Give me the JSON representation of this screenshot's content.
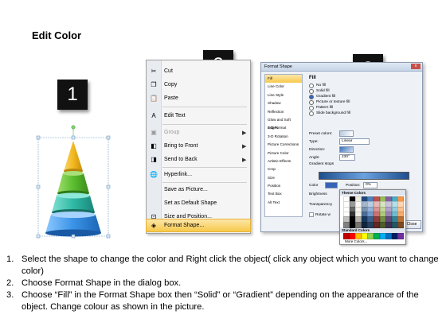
{
  "title": "Edit Color",
  "badges": [
    "1",
    "2",
    "3"
  ],
  "context_menu": {
    "items": [
      {
        "label": "Cut",
        "icon": "scissors-icon",
        "glyph": "✂",
        "disabled": false,
        "submenu": false
      },
      {
        "label": "Copy",
        "icon": "copy-icon",
        "glyph": "❐",
        "disabled": false,
        "submenu": false
      },
      {
        "label": "Paste",
        "icon": "paste-icon",
        "glyph": "📋",
        "disabled": false,
        "submenu": false
      },
      {
        "label": "Edit Text",
        "icon": "edit-text-icon",
        "glyph": "A",
        "disabled": false,
        "submenu": false
      },
      {
        "label": "Group",
        "icon": "group-icon",
        "glyph": "▣",
        "disabled": true,
        "submenu": true
      },
      {
        "label": "Bring to Front",
        "icon": "bring-front-icon",
        "glyph": "◧",
        "disabled": false,
        "submenu": true
      },
      {
        "label": "Send to Back",
        "icon": "send-back-icon",
        "glyph": "◨",
        "disabled": false,
        "submenu": true
      },
      {
        "label": "Hyperlink...",
        "icon": "hyperlink-icon",
        "glyph": "🌐",
        "disabled": false,
        "submenu": false
      },
      {
        "label": "Save as Picture...",
        "icon": "",
        "glyph": "",
        "disabled": false,
        "submenu": false
      },
      {
        "label": "Set as Default Shape",
        "icon": "",
        "glyph": "",
        "disabled": false,
        "submenu": false
      },
      {
        "label": "Size and Position...",
        "icon": "size-position-icon",
        "glyph": "⊡",
        "disabled": false,
        "submenu": false
      },
      {
        "label": "Format Shape...",
        "icon": "format-shape-icon",
        "glyph": "◈",
        "disabled": false,
        "submenu": false,
        "highlighted": true
      }
    ]
  },
  "format_dialog": {
    "title": "Format Shape",
    "close_glyph": "x",
    "categories": [
      "Fill",
      "Line Color",
      "Line Style",
      "Shadow",
      "Reflection",
      "Glow and Soft Edges",
      "3-D Format",
      "3-D Rotation",
      "Picture Corrections",
      "Picture Color",
      "Artistic Effects",
      "Crop",
      "Size",
      "Position",
      "Text Box",
      "Alt Text"
    ],
    "selected_category": "Fill",
    "pane_heading": "Fill",
    "fill_options": [
      {
        "label": "No fill",
        "selected": false
      },
      {
        "label": "Solid fill",
        "selected": false
      },
      {
        "label": "Gradient fill",
        "selected": true
      },
      {
        "label": "Picture or texture fill",
        "selected": false
      },
      {
        "label": "Pattern fill",
        "selected": false
      },
      {
        "label": "Slide background fill",
        "selected": false
      }
    ],
    "preset_colors_label": "Preset colors:",
    "type_label": "Type:",
    "type_value": "Linear",
    "direction_label": "Direction:",
    "angle_label": "Angle:",
    "angle_value": "230°",
    "gradient_stops_label": "Gradient stops",
    "color_label": "Color",
    "position_label": "Position:",
    "position_value": "0%",
    "brightness_label": "Brightness",
    "transparency_label": "Transparency",
    "rotate_label": "Rotate w",
    "close_button": "Close",
    "palette": {
      "theme_label": "Theme Colors",
      "standard_label": "Standard Colors",
      "more_label": "More Colors...",
      "theme_colors": [
        "#ffffff",
        "#000000",
        "#eeece1",
        "#1f497d",
        "#4f81bd",
        "#c0504d",
        "#9bbb59",
        "#8064a2",
        "#4bacc6",
        "#f79646"
      ],
      "standard_colors": [
        "#c00000",
        "#ff0000",
        "#ffc000",
        "#ffff00",
        "#92d050",
        "#00b050",
        "#00b0f0",
        "#0070c0",
        "#002060",
        "#7030a0"
      ]
    }
  },
  "instructions": [
    {
      "num": "1.",
      "text": "Select the shape to change the color and Right click the object( click any object which you want to change color)"
    },
    {
      "num": "2.",
      "text": "Choose Format Shape in the dialog box."
    },
    {
      "num": "3.",
      "text": "Choose “Fill” in the Format Shape box then “Solid” or “Gradient” depending on the appearance of the object. Change colour as shown in the picture."
    }
  ]
}
